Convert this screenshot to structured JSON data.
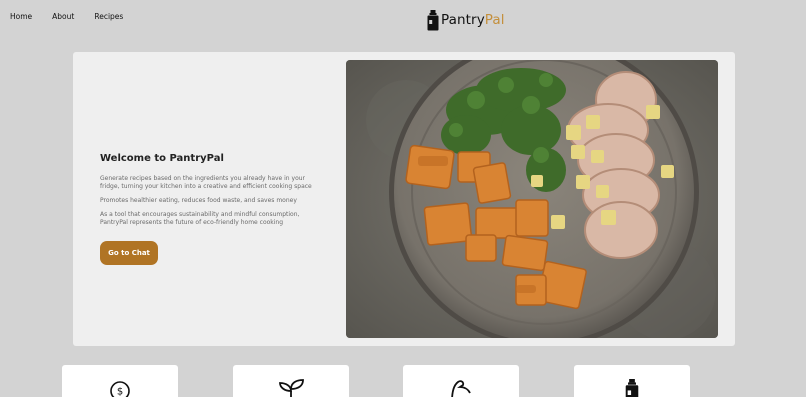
{
  "nav": {
    "items": [
      {
        "label": "Home"
      },
      {
        "label": "About"
      },
      {
        "label": "Recipes"
      }
    ]
  },
  "brand": {
    "part1": "Pantry",
    "part2": "Pal",
    "accent_color": "#c48f3b"
  },
  "hero": {
    "title": "Welcome to PantryPal",
    "paragraphs": [
      "Generate recipes based on the ingredients you already have in your fridge, turning your kitchen into a creative and efficient cooking space",
      "Promotes healthier eating, reduces food waste, and saves money",
      "As a tool that encourages sustainability and mindful consumption, PantryPal represents the future of eco-friendly home cooking"
    ],
    "cta_label": "Go to Chat",
    "cta_color": "#b07424",
    "image_alt": "plate of roasted sweet potatoes, kale, sliced pork and apples"
  },
  "features": [
    {
      "icon": "piggy-bank-dollar-icon"
    },
    {
      "icon": "sprout-icon"
    },
    {
      "icon": "flexed-arm-icon"
    },
    {
      "icon": "pantry-jar-icon"
    }
  ]
}
